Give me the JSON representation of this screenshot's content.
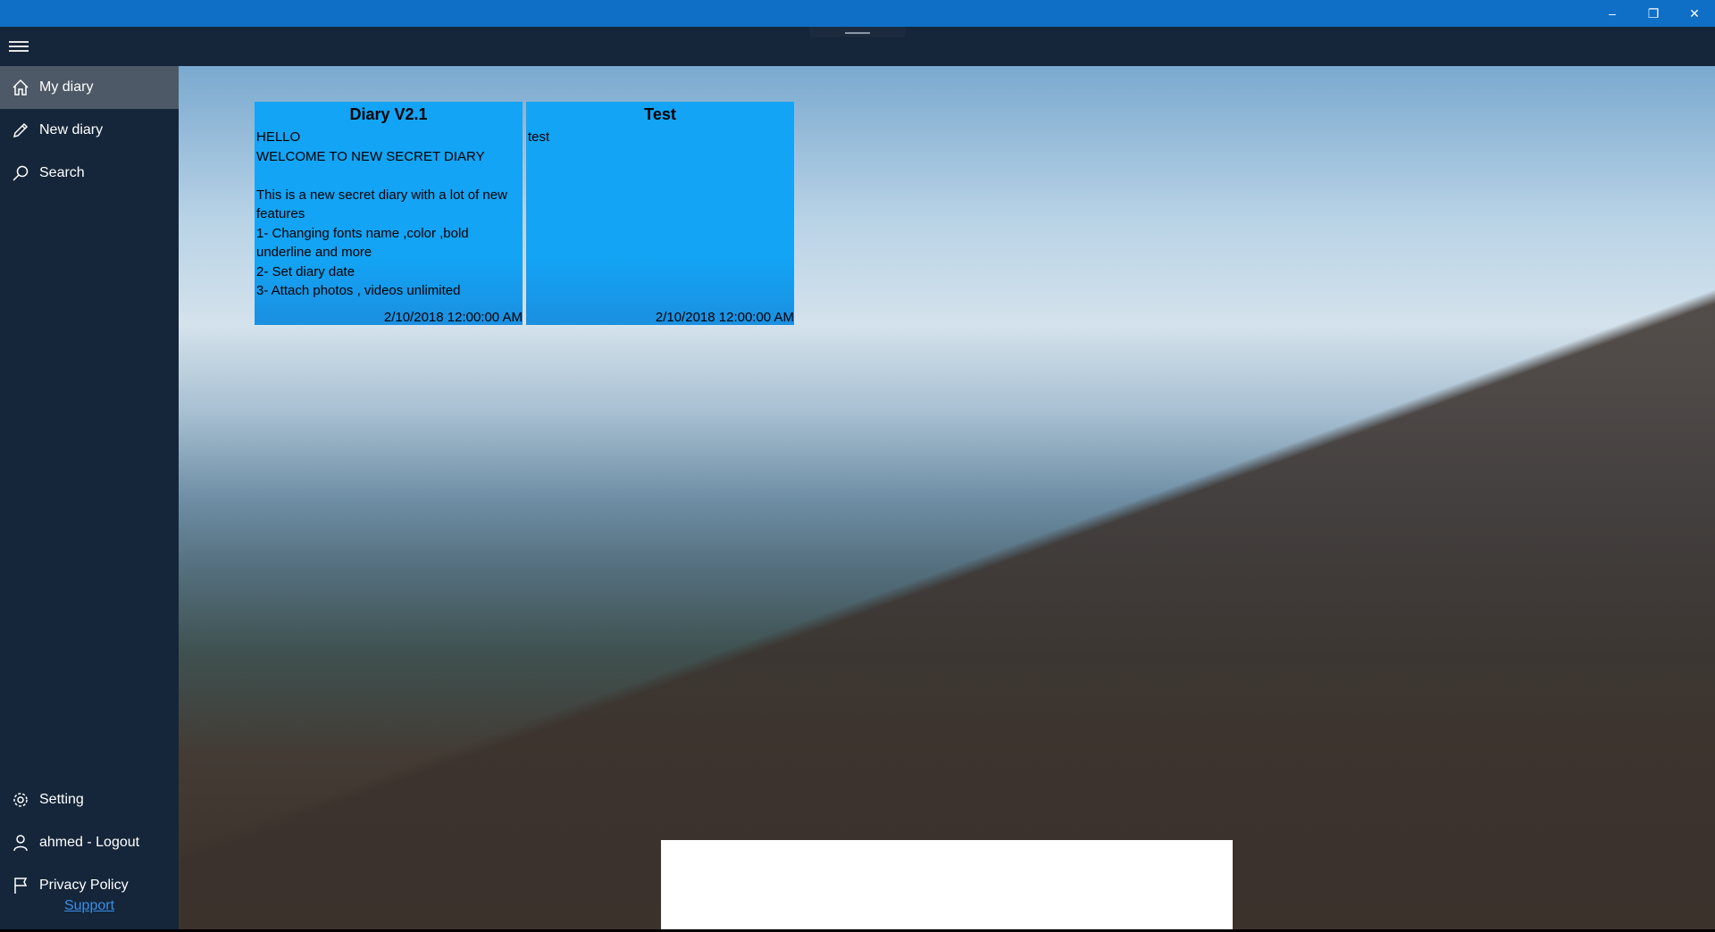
{
  "window": {
    "minimize_glyph": "–",
    "maximize_glyph": "❐",
    "close_glyph": "✕"
  },
  "sidebar": {
    "items": [
      {
        "label": "My diary",
        "icon": "home-icon",
        "active": true
      },
      {
        "label": "New diary",
        "icon": "pencil-icon",
        "active": false
      },
      {
        "label": "Search",
        "icon": "search-icon",
        "active": false
      }
    ],
    "bottom_items": [
      {
        "label": "Setting",
        "icon": "gear-icon"
      },
      {
        "label": "ahmed - Logout",
        "icon": "person-icon"
      },
      {
        "label": "Privacy Policy",
        "icon": "flag-icon"
      }
    ],
    "support_link": "Support"
  },
  "diaries": [
    {
      "title": "Diary V2.1",
      "body": "HELLO\nWELCOME TO NEW SECRET DIARY\n\nThis is a new secret diary with a lot of new features\n1- Changing fonts name ,color ,bold underline and more\n2- Set diary date\n3- Attach photos , videos unlimited",
      "date": "2/10/2018 12:00:00 AM"
    },
    {
      "title": "Test",
      "body": "test",
      "date": "2/10/2018 12:00:00 AM"
    }
  ],
  "colors": {
    "titlebar": "#0f6ec6",
    "sidebar": "#15263a",
    "card": "#13a4f5",
    "link": "#3a8ee6"
  }
}
